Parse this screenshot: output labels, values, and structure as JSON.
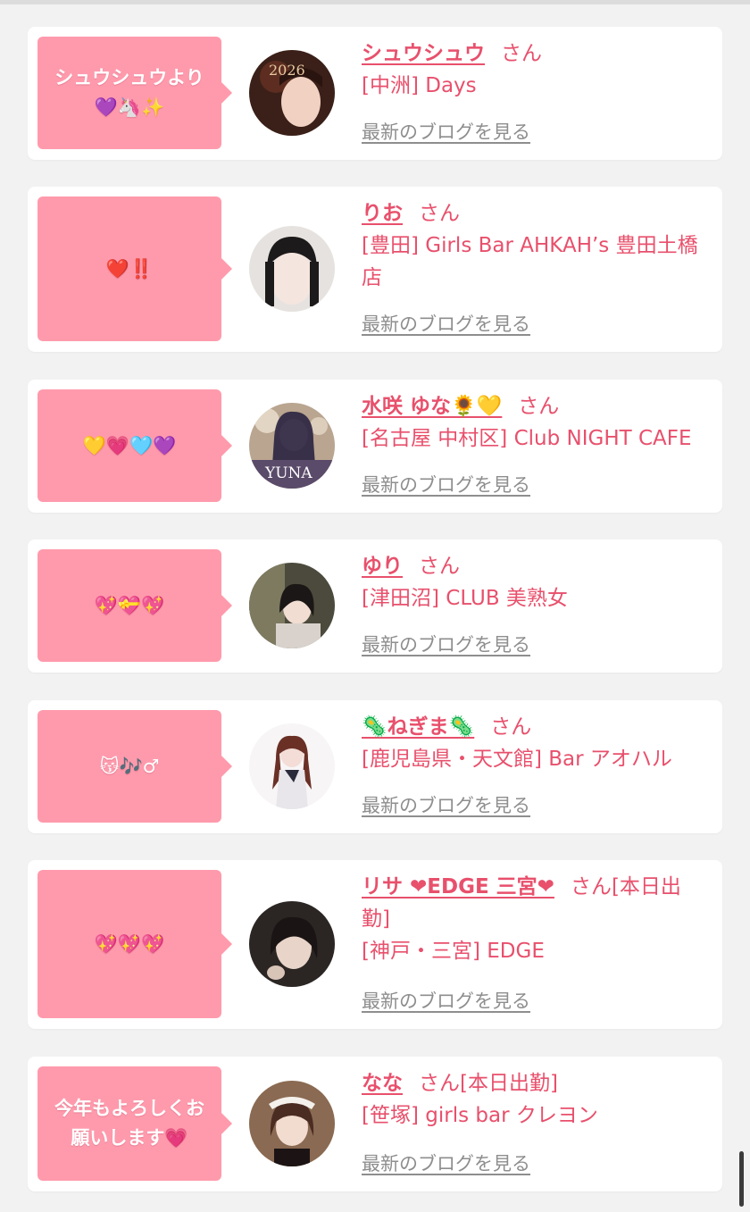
{
  "colors": {
    "accent": "#e8506c",
    "bubble": "#ff9aac",
    "muted_link": "#8e8e8e",
    "background": "#f2f2f2"
  },
  "blog_link_label": "最新のブログを見る",
  "honorific": "さん",
  "cards": [
    {
      "message": "シュウシュウより\n💜🦄✨",
      "name": "シュウシュウ",
      "suffix": "",
      "shop": "[中洲] Days",
      "avatar_icon": "avatar-photo-1"
    },
    {
      "message": "❤️‼️",
      "name": "りお",
      "suffix": "",
      "shop": "[豊田] Girls Bar AHKAH’s 豊田土橋店",
      "avatar_icon": "avatar-photo-2"
    },
    {
      "message": "💛💗🩵💜",
      "name": "水咲 ゆな🌻💛",
      "suffix": "",
      "shop": "[名古屋 中村区] Club NIGHT CAFE",
      "avatar_icon": "avatar-photo-3"
    },
    {
      "message": "💖💝💖",
      "name": "ゆり",
      "suffix": "",
      "shop": "[津田沼] CLUB 美熟女",
      "avatar_icon": "avatar-photo-4"
    },
    {
      "message": "😽🎶♂",
      "name": "🦠ねぎま🦠",
      "suffix": "",
      "shop": "[鹿児島県・天文館] Bar アオハル",
      "avatar_icon": "avatar-photo-5"
    },
    {
      "message": "💖💖💖",
      "name": "リサ ❤EDGE 三宮❤",
      "suffix": "[本日出勤]",
      "shop": "[神戸・三宮] EDGE",
      "avatar_icon": "avatar-photo-6"
    },
    {
      "message": "今年もよろしくお\n願いします💗",
      "name": "なな",
      "suffix": "[本日出勤]",
      "shop": "[笹塚] girls bar クレヨン",
      "avatar_icon": "avatar-photo-7"
    }
  ]
}
